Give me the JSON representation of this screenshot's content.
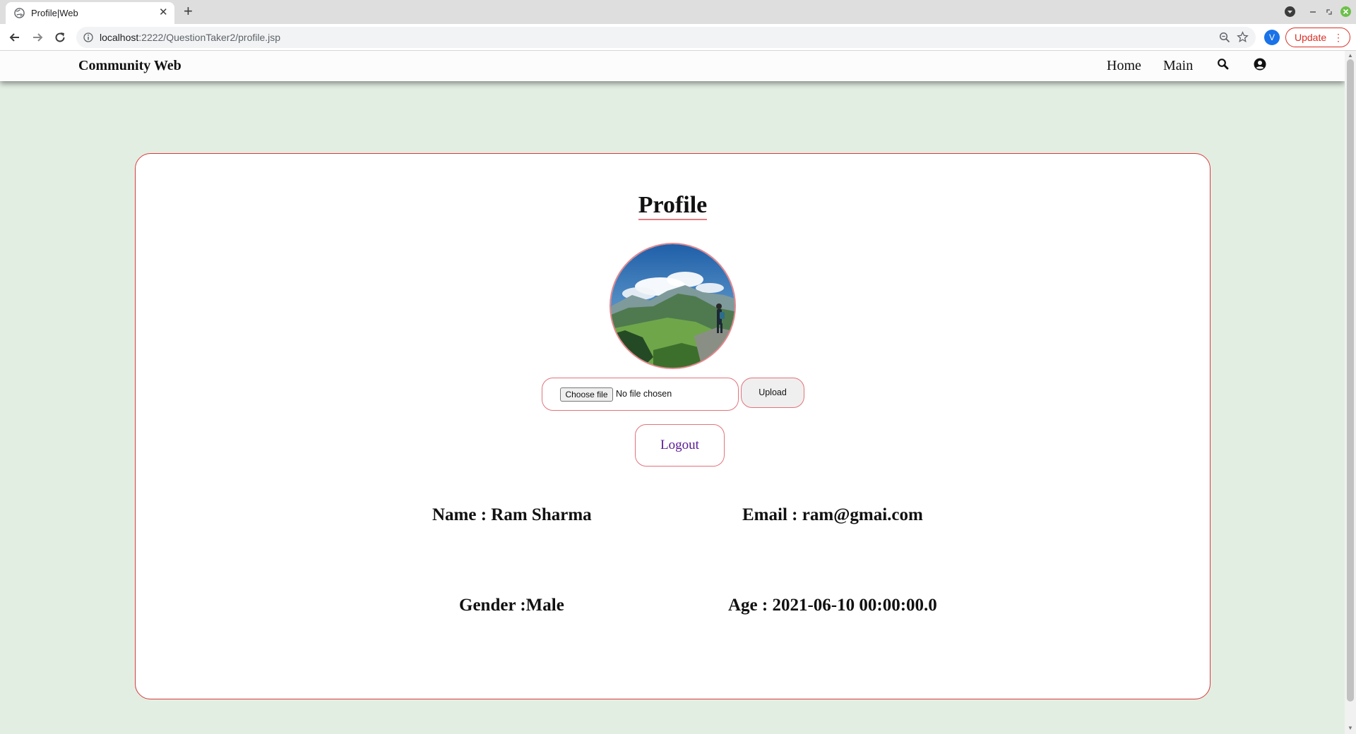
{
  "browser": {
    "tab_title": "Profile|Web",
    "url_host": "localhost",
    "url_rest": ":2222/QuestionTaker2/profile.jsp",
    "profile_initial": "V",
    "update_label": "Update"
  },
  "navbar": {
    "brand": "Community Web",
    "links": [
      "Home",
      "Main"
    ]
  },
  "profile": {
    "title": "Profile",
    "avatar_description": "landscape-photo",
    "file_input": {
      "button_label": "Choose file",
      "status": "No file chosen"
    },
    "upload_label": "Upload",
    "logout_label": "Logout",
    "name": "Name : Ram Sharma",
    "email": "Email : ram@gmai.com",
    "gender": "Gender :Male",
    "age": "Age : 2021-06-10 00:00:00.0"
  },
  "colors": {
    "page_background": "#e3eee3",
    "card_border": "#d83a3a",
    "accent_border": "#e2737b",
    "logout_text": "#5a1a94"
  }
}
